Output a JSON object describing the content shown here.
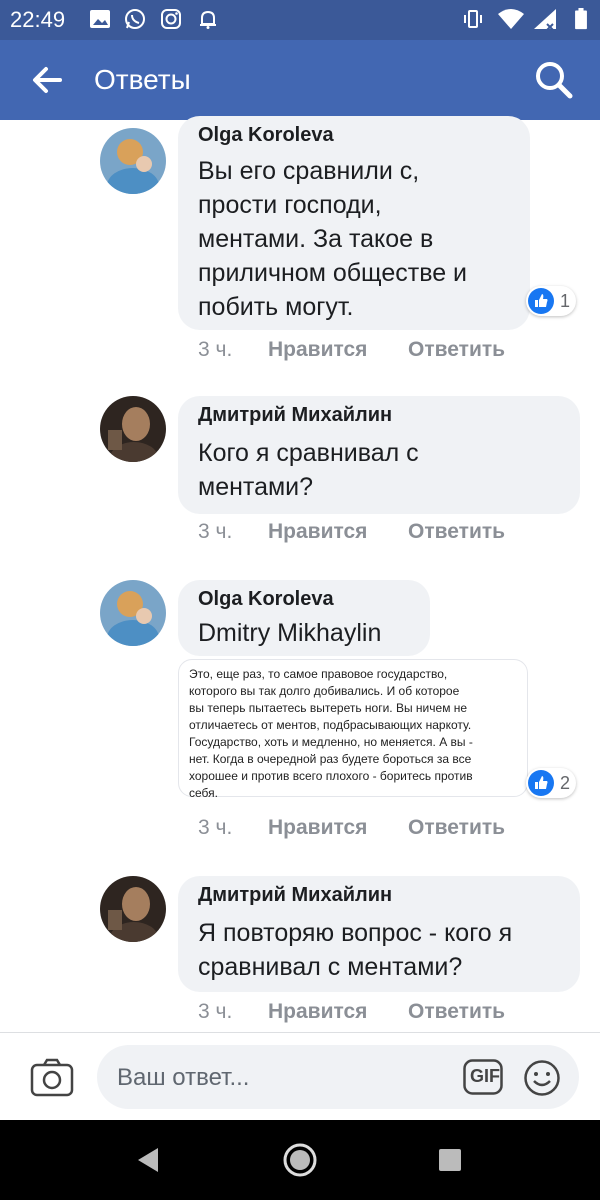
{
  "status_bar": {
    "time": "22:49",
    "left_icons": [
      "image-icon",
      "whatsapp-icon",
      "instagram-icon",
      "bell-icon"
    ],
    "right_icons": [
      "vibrate-icon",
      "wifi-icon",
      "signal-icon",
      "battery-icon"
    ]
  },
  "header": {
    "title": "Ответы",
    "back_icon": "arrow-left-icon",
    "search_icon": "search-icon",
    "bg_color": "#4267b2"
  },
  "comments": [
    {
      "author": "Olga Koroleva",
      "lines": [
        "Вы его сравнили с,",
        "прости господи,",
        "ментами. За такое в",
        "приличном обществе и",
        "побить могут."
      ],
      "time": "3 ч.",
      "like_label": "Нравится",
      "reply_label": "Ответить",
      "reaction_count": "1"
    },
    {
      "author": "Дмитрий Михайлин",
      "lines": [
        "Кого я сравнивал с",
        "ментами?"
      ],
      "time": "3 ч.",
      "like_label": "Нравится",
      "reply_label": "Ответить"
    },
    {
      "author": "Olga Koroleva",
      "lines": [
        "Dmitry  Mikhaylin"
      ],
      "attachment_text": "Это, еще раз, то самое правовое государство,\nкоторого вы так долго добивались. И об которое\nвы теперь пытаетесь вытереть ноги. Вы ничем не\nотличаетесь от ментов, подбрасывающих наркоту.\nГосударство, хоть и медленно, но меняется. А вы -\nнет. Когда в очередной раз будете бороться за все\nхорошее и против всего плохого - боритесь против\nсебя.",
      "time": "3 ч.",
      "like_label": "Нравится",
      "reply_label": "Ответить",
      "reaction_count": "2"
    },
    {
      "author": "Дмитрий Михайлин",
      "lines": [
        "Я повторяю вопрос - кого я",
        "сравнивал с ментами?"
      ],
      "time": "3 ч.",
      "like_label": "Нравится",
      "reply_label": "Ответить"
    }
  ],
  "composer": {
    "placeholder": "Ваш ответ...",
    "camera_icon": "camera-icon",
    "gif_label": "GIF",
    "emoji_icon": "smiley-icon"
  },
  "nav_bar": {
    "icons": [
      "back-triangle-icon",
      "home-circle-icon",
      "recent-square-icon"
    ]
  }
}
